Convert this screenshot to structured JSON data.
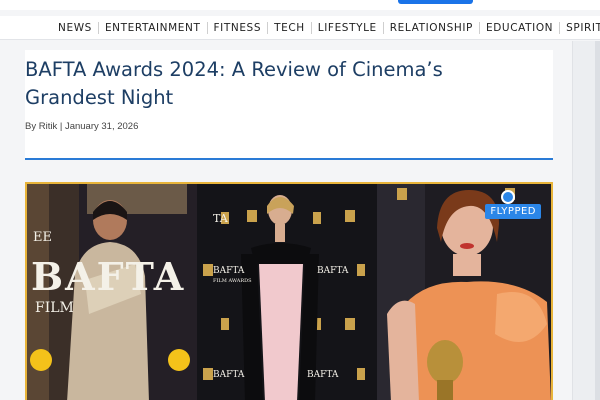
{
  "nav": {
    "items": [
      "NEWS",
      "ENTERTAINMENT",
      "FITNESS",
      "TECH",
      "LIFESTYLE",
      "RELATIONSHIP",
      "EDUCATION",
      "SPIRITUAL"
    ]
  },
  "article": {
    "title": "BAFTA Awards 2024: A Review of Cinema’s Grandest Night",
    "meta": "By Ritik | January 31, 2026"
  },
  "hero": {
    "watermark": "FLYPPED",
    "backdrop_big": "BAFTA",
    "backdrop_ee": "EE",
    "backdrop_film": "FILM",
    "backdrop_small": "BAFTA",
    "backdrop_small_sub": "FILM AWARDS",
    "backdrop_fragment": "TA"
  },
  "colors": {
    "accent": "#2a7bd6",
    "title": "#1d3e64",
    "frame": "#e8b43a",
    "brand": "#2b86e8"
  }
}
